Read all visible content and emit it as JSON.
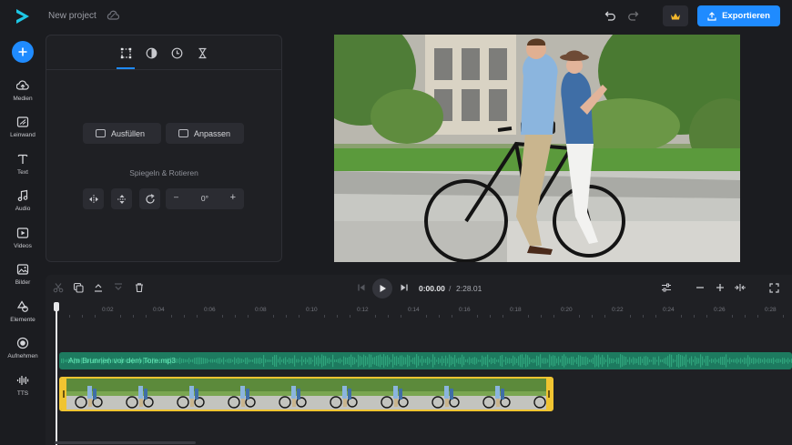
{
  "header": {
    "project_title": "New project",
    "export_label": "Exportieren",
    "accent": "#1f8bff"
  },
  "sidebar": {
    "items": [
      {
        "label": "Medien",
        "icon": "upload-icon"
      },
      {
        "label": "Leinwand",
        "icon": "canvas-icon"
      },
      {
        "label": "Text",
        "icon": "text-icon"
      },
      {
        "label": "Audio",
        "icon": "music-icon"
      },
      {
        "label": "Videos",
        "icon": "video-icon"
      },
      {
        "label": "Bilder",
        "icon": "image-icon"
      },
      {
        "label": "Elemente",
        "icon": "shapes-icon"
      },
      {
        "label": "Aufnehmen",
        "icon": "record-icon"
      },
      {
        "label": "TTS",
        "icon": "waveform-icon"
      }
    ]
  },
  "panel": {
    "fill_label": "Ausfüllen",
    "fit_label": "Anpassen",
    "section_label": "Spiegeln & Rotieren",
    "rotation_value": "0°"
  },
  "timeline": {
    "current_time": "0:00.00",
    "separator": "/",
    "total_time": "2:28.01",
    "ruler_ticks": [
      "0",
      "0:02",
      "0:04",
      "0:06",
      "0:08",
      "0:10",
      "0:12",
      "0:14",
      "0:16",
      "0:18",
      "0:20",
      "0:22",
      "0:24",
      "0:26",
      "0:28"
    ],
    "audio_clip_name": "Am Brunnen vor dem Tore.mp3",
    "audio_color": "#1d7a5f",
    "video_selection_color": "#f0c431"
  }
}
